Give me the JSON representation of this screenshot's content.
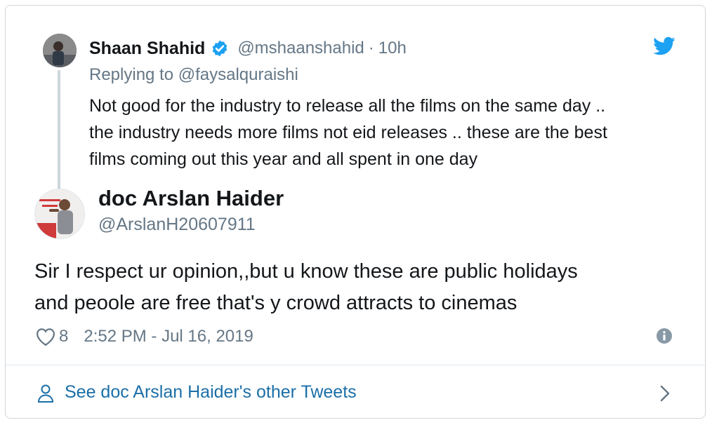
{
  "parent_tweet": {
    "author_name": "Shaan Shahid",
    "handle": "@mshaanshahid",
    "separator": "·",
    "time": "10h",
    "replying_to": "Replying to @faysalquraishi",
    "text_lines": [
      "Not good for the industry to release all the films on the same day ..",
      "the industry needs more films not eid releases .. these are  the best",
      "films coming out this year and all spent in one day"
    ],
    "icons": {
      "verified": "verified-badge-icon",
      "brand": "twitter-bird-icon"
    }
  },
  "tweet": {
    "author_name": "doc Arslan Haider",
    "handle": "@ArslanH20607911",
    "text_lines": [
      "Sir I respect ur opinion,,but u know these are public holidays",
      "and peoole are free that's y crowd attracts to cinemas"
    ],
    "like_count": "8",
    "timestamp": "2:52 PM - Jul 16, 2019",
    "icons": {
      "like": "heart-icon",
      "info": "info-icon"
    }
  },
  "footer": {
    "see_more_label": "See doc Arslan Haider's other Tweets",
    "icons": {
      "person": "person-icon",
      "chevron": "chevron-right-icon"
    }
  },
  "colors": {
    "text_primary": "#14171a",
    "text_secondary": "#657786",
    "link_blue": "#1b6fa8",
    "twitter_blue": "#1da1f2",
    "border": "#d0d6db",
    "thread_line": "#ccd6dd"
  }
}
